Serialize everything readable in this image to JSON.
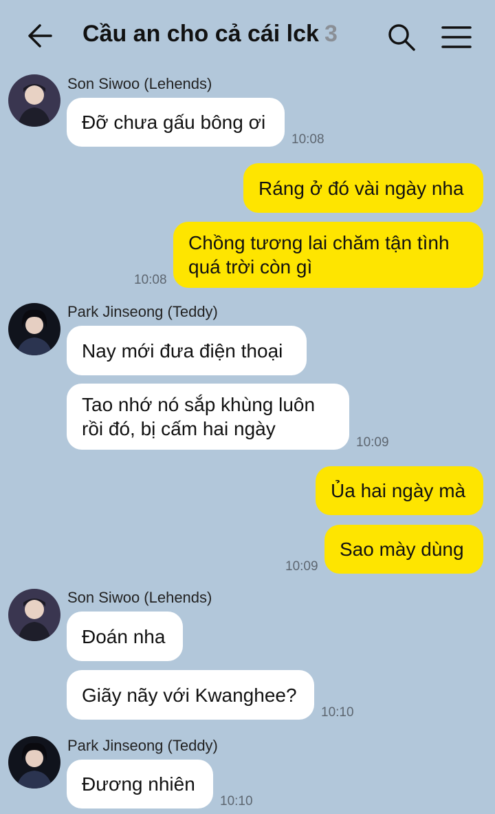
{
  "header": {
    "title": "Cầu an cho cả cái lck",
    "member_count": "3"
  },
  "messages": [
    {
      "sender": "Son Siwoo (Lehends)",
      "text": "Đỡ chưa gấu bông ơi",
      "time": "10:08"
    },
    {
      "text": "Ráng ở đó vài ngày nha"
    },
    {
      "text": "Chồng tương lai chăm tận tình quá trời còn gì",
      "time": "10:08"
    },
    {
      "sender": "Park Jinseong (Teddy)",
      "text": "Nay mới đưa điện thoại"
    },
    {
      "text": "Tao nhớ nó sắp khùng luôn rồi đó, bị cấm hai ngày",
      "time": "10:09"
    },
    {
      "text": "Ủa hai ngày mà"
    },
    {
      "text": "Sao mày dùng",
      "time": "10:09"
    },
    {
      "sender": "Son Siwoo (Lehends)",
      "text": "Đoán nha"
    },
    {
      "text": "Giãy nãy với Kwanghee?",
      "time": "10:10"
    },
    {
      "sender": "Park Jinseong (Teddy)",
      "text": "Đương nhiên",
      "time": "10:10"
    }
  ],
  "colors": {
    "background": "#b2c7da",
    "incoming_bubble": "#ffffff",
    "outgoing_bubble": "#fee500",
    "timestamp": "#5d6670"
  },
  "icons": [
    "back-arrow-icon",
    "search-icon",
    "menu-icon"
  ]
}
